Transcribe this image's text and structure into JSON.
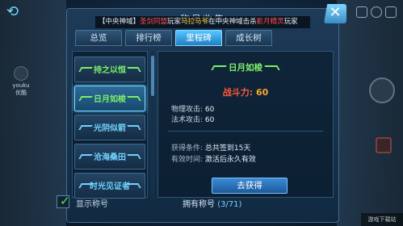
{
  "window": {
    "title": "称号收集",
    "close_label": "✕"
  },
  "tabs": [
    {
      "label": "总览",
      "active": false
    },
    {
      "label": "排行榜",
      "active": false
    },
    {
      "label": "里程碑",
      "active": true
    },
    {
      "label": "成长树",
      "active": false
    }
  ],
  "marquee": {
    "prefix": "【中央神域】",
    "guild": "圣剑同盟",
    "player_word": "玩家",
    "player_name": "马拉马爷",
    "mid": "在中央神域击杀",
    "victim": "影月精灵",
    "suffix": "玩家"
  },
  "titles": [
    {
      "label": "持之以恒",
      "color": "green",
      "selected": false
    },
    {
      "label": "日月如梭",
      "color": "green",
      "selected": true
    },
    {
      "label": "光阴似箭",
      "color": "blue",
      "selected": false
    },
    {
      "label": "沧海桑田",
      "color": "blue",
      "selected": false
    },
    {
      "label": "时光见证者",
      "color": "blue",
      "selected": false
    }
  ],
  "detail": {
    "name": "日月如梭",
    "power_label": "战斗力:",
    "power_value": "60",
    "phys_label": "物理攻击:",
    "phys_value": "60",
    "magic_label": "法术攻击:",
    "magic_value": "60",
    "cond_label": "获得条件:",
    "cond_value": "总共签到15天",
    "time_label": "有效时间:",
    "time_value": "激活后永久有效",
    "button": "去获得"
  },
  "bottom": {
    "show_label": "显示称号",
    "show_checked": true,
    "owned_label": "拥有称号",
    "owned_count": "(3/71)"
  },
  "watermark": {
    "brand": "youku",
    "sub": "优酷"
  },
  "corner_mark": "游戏下载站"
}
